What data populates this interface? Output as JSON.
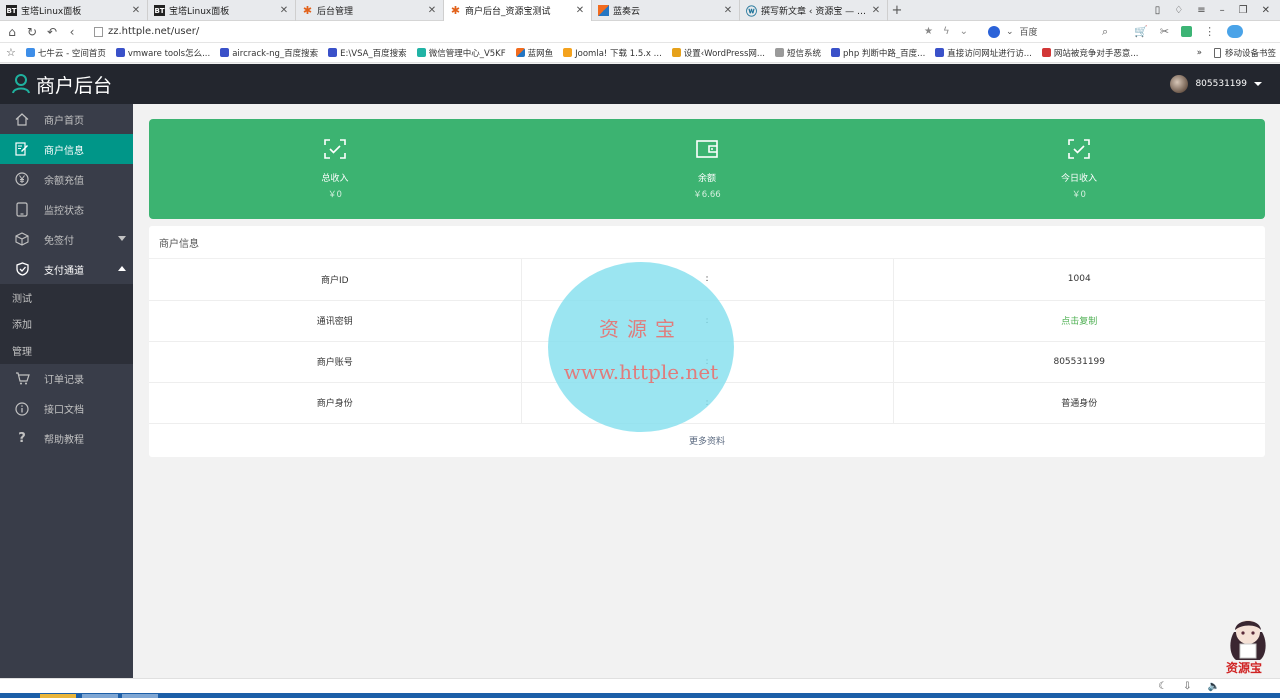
{
  "browser": {
    "tabs": [
      {
        "favicon": "BT",
        "title": "宝塔Linux面板",
        "active": false
      },
      {
        "favicon": "BT",
        "title": "宝塔Linux面板",
        "active": false
      },
      {
        "favicon": "✱",
        "title": "后台管理",
        "active": false
      },
      {
        "favicon": "✱",
        "title": "商户后台_资源宝测试",
        "active": true
      },
      {
        "favicon": "",
        "title": "蓝奏云",
        "active": false
      },
      {
        "favicon": "W",
        "title": "撰写新文章 ‹ 资源宝 — Wor",
        "active": false
      }
    ],
    "address": "zz.httple.net/user/",
    "search_engine": "百度",
    "bookmarks": [
      "七牛云 - 空间首页",
      "vmware tools怎么...",
      "aircrack-ng_百度搜索",
      "E:\\VSA_百度搜索",
      "微信管理中心_V5KF",
      "蓝网鱼",
      "Joomla! 下载 1.5.x ...",
      "设置‹WordPress网...",
      "短信系统",
      "php 判断中路_百度...",
      "直接访问网址进行访...",
      "网站被竞争对手恶意..."
    ],
    "bookmark_more": "»",
    "mobile_bookmarks": "移动设备书签"
  },
  "header": {
    "title": "商户后台",
    "username": "805531199"
  },
  "sidebar": {
    "items": [
      {
        "label": "商户首页",
        "icon": "home-icon"
      },
      {
        "label": "商户信息",
        "icon": "edit-icon"
      },
      {
        "label": "余额充值",
        "icon": "yen-icon"
      },
      {
        "label": "监控状态",
        "icon": "tablet-icon"
      },
      {
        "label": "免签付",
        "icon": "cube-icon"
      },
      {
        "label": "支付通道",
        "icon": "shield-icon"
      }
    ],
    "sub_items": [
      "测试",
      "添加",
      "管理"
    ],
    "bottom_items": [
      {
        "label": "订单记录",
        "icon": "cart-icon"
      },
      {
        "label": "接口文档",
        "icon": "info-icon"
      },
      {
        "label": "帮助教程",
        "icon": "question-icon"
      }
    ]
  },
  "stats": [
    {
      "label": "总收入",
      "value": "￥0",
      "icon": "scan-check-icon"
    },
    {
      "label": "余额",
      "value": "￥6.66",
      "icon": "wallet-icon"
    },
    {
      "label": "今日收入",
      "value": "￥0",
      "icon": "scan-check-icon"
    }
  ],
  "info": {
    "title": "商户信息",
    "rows": [
      {
        "name": "商户ID",
        "sep": ":",
        "value": "1004"
      },
      {
        "name": "通讯密钥",
        "sep": ":",
        "value": "点击复制"
      },
      {
        "name": "商户账号",
        "sep": ":",
        "value": "805531199"
      },
      {
        "name": "商户身份",
        "sep": ":",
        "value": "普通身份"
      }
    ],
    "more": "更多资料"
  },
  "watermark": {
    "line1": "资源宝",
    "line2": "www.httple.net"
  },
  "mascot_label": "资源宝",
  "colors": {
    "header_bg": "#23262e",
    "sidebar_bg": "#393d49",
    "active_teal": "#009688",
    "stats_green": "#3cb371",
    "copy_link_green": "#4caf50"
  }
}
